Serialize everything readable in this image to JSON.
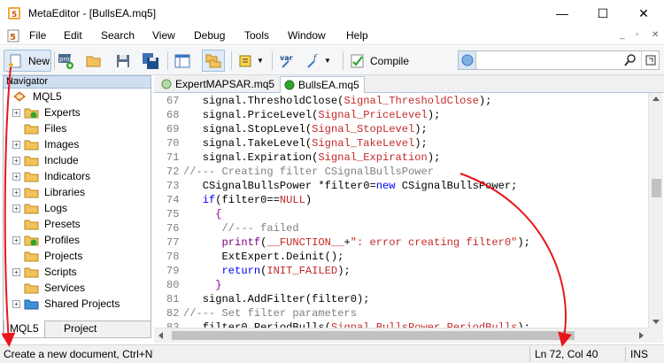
{
  "window": {
    "title": "MetaEditor - [BullsEA.mq5]",
    "minimize": "—",
    "maximize": "☐",
    "close": "✕"
  },
  "menu": {
    "items": [
      "File",
      "Edit",
      "Search",
      "View",
      "Debug",
      "Tools",
      "Window",
      "Help"
    ],
    "mdi_controls": [
      "_",
      "▫",
      "✕"
    ]
  },
  "toolbar": {
    "new_label": "New",
    "compile_label": "Compile",
    "var_label": "var",
    "f_label": "f",
    "search_placeholder": ""
  },
  "navigator": {
    "title": "Navigator",
    "close": "✕",
    "root": "MQL5",
    "items": [
      {
        "label": "Experts",
        "expandable": true,
        "badge": "green"
      },
      {
        "label": "Files",
        "expandable": false
      },
      {
        "label": "Images",
        "expandable": true
      },
      {
        "label": "Include",
        "expandable": true
      },
      {
        "label": "Indicators",
        "expandable": true
      },
      {
        "label": "Libraries",
        "expandable": true
      },
      {
        "label": "Logs",
        "expandable": true
      },
      {
        "label": "Presets",
        "expandable": false
      },
      {
        "label": "Profiles",
        "expandable": true,
        "badge": "green"
      },
      {
        "label": "Projects",
        "expandable": false
      },
      {
        "label": "Scripts",
        "expandable": true
      },
      {
        "label": "Services",
        "expandable": false
      },
      {
        "label": "Shared Projects",
        "expandable": true,
        "highlighted": true
      }
    ],
    "tabs": [
      "MQL5",
      "Project"
    ],
    "active_tab": "MQL5"
  },
  "editor": {
    "tabs": [
      "ExpertMAPSAR.mq5",
      "BullsEA.mq5"
    ],
    "active_tab": "BullsEA.mq5",
    "lines": [
      {
        "n": "67",
        "indent": "   ",
        "parts": [
          [
            "signal.ThresholdClose(",
            "n"
          ],
          [
            "Signal_ThresholdClose",
            "s"
          ],
          [
            ");",
            "n"
          ]
        ]
      },
      {
        "n": "68",
        "indent": "   ",
        "parts": [
          [
            "signal.PriceLevel(",
            "n"
          ],
          [
            "Signal_PriceLevel",
            "s"
          ],
          [
            ");",
            "n"
          ]
        ]
      },
      {
        "n": "69",
        "indent": "   ",
        "parts": [
          [
            "signal.StopLevel(",
            "n"
          ],
          [
            "Signal_StopLevel",
            "s"
          ],
          [
            ");",
            "n"
          ]
        ]
      },
      {
        "n": "70",
        "indent": "   ",
        "parts": [
          [
            "signal.TakeLevel(",
            "n"
          ],
          [
            "Signal_TakeLevel",
            "s"
          ],
          [
            ");",
            "n"
          ]
        ]
      },
      {
        "n": "71",
        "indent": "   ",
        "parts": [
          [
            "signal.Expiration(",
            "n"
          ],
          [
            "Signal_Expiration",
            "s"
          ],
          [
            ");",
            "n"
          ]
        ]
      },
      {
        "n": "72",
        "indent": "",
        "parts": [
          [
            "//--- Creating filter CSignalBullsPower",
            "c"
          ]
        ]
      },
      {
        "n": "73",
        "indent": "   ",
        "parts": [
          [
            "CSignalBullsPower *filter0=",
            "n"
          ],
          [
            "new",
            "k"
          ],
          [
            " CSignalBullsPower;",
            "n"
          ]
        ]
      },
      {
        "n": "74",
        "indent": "   ",
        "parts": [
          [
            "if",
            "k"
          ],
          [
            "(filter0==",
            "n"
          ],
          [
            "NULL",
            "s"
          ],
          [
            ")",
            "n"
          ]
        ]
      },
      {
        "n": "75",
        "indent": "     ",
        "parts": [
          [
            "{",
            "b"
          ]
        ]
      },
      {
        "n": "76",
        "indent": "      ",
        "parts": [
          [
            "//--- failed",
            "c"
          ]
        ]
      },
      {
        "n": "77",
        "indent": "      ",
        "parts": [
          [
            "printf",
            "f"
          ],
          [
            "(",
            "n"
          ],
          [
            "__FUNCTION__",
            "s"
          ],
          [
            "+",
            "n"
          ],
          [
            "\": error creating filter0\"",
            "s"
          ],
          [
            ");",
            "n"
          ]
        ]
      },
      {
        "n": "78",
        "indent": "      ",
        "parts": [
          [
            "ExtExpert.Deinit();",
            "n"
          ]
        ]
      },
      {
        "n": "79",
        "indent": "      ",
        "parts": [
          [
            "return",
            "k"
          ],
          [
            "(",
            "n"
          ],
          [
            "INIT_FAILED",
            "s"
          ],
          [
            ");",
            "n"
          ]
        ]
      },
      {
        "n": "80",
        "indent": "     ",
        "parts": [
          [
            "}",
            "b"
          ]
        ]
      },
      {
        "n": "81",
        "indent": "   ",
        "parts": [
          [
            "signal.AddFilter(filter0);",
            "n"
          ]
        ]
      },
      {
        "n": "82",
        "indent": "",
        "parts": [
          [
            "//--- Set filter parameters",
            "c"
          ]
        ]
      },
      {
        "n": "83",
        "indent": "   ",
        "parts": [
          [
            "filter0.PeriodBulls(",
            "n"
          ],
          [
            "Signal_BullsPower_PeriodBulls",
            "s"
          ],
          [
            ");",
            "n"
          ]
        ]
      }
    ]
  },
  "status": {
    "message": "Create a new document, Ctrl+N",
    "position": "Ln 72, Col 40",
    "mode": "INS"
  },
  "colors": {
    "string": "#c32a2a",
    "comment": "#808080",
    "keyword": "#0000ff",
    "function": "#800080",
    "annotation_arrow": "#e8161b",
    "folder": "#f2c25c",
    "folder_blue": "#3d8fd9"
  }
}
